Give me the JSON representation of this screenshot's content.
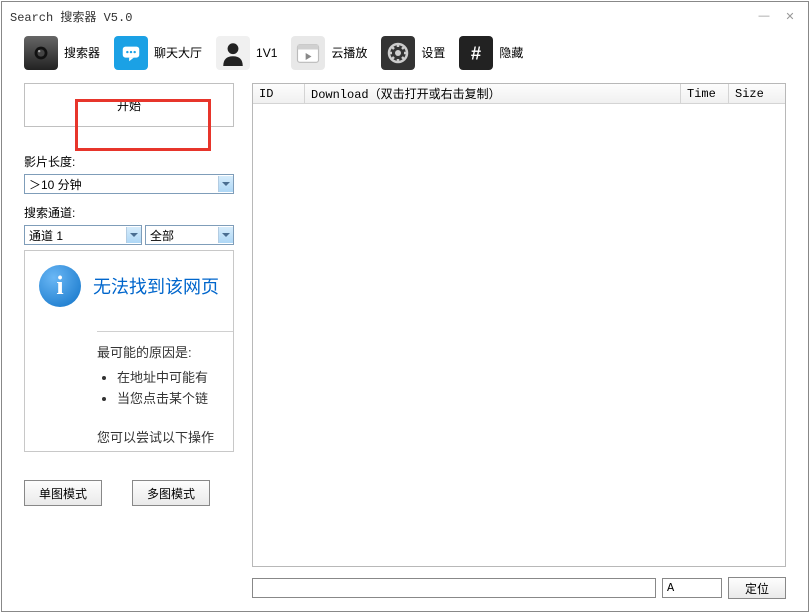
{
  "window": {
    "title": "Search 搜索器 V5.0"
  },
  "toolbar": {
    "items": [
      {
        "icon": "camera-icon",
        "label": "搜索器"
      },
      {
        "icon": "chat-icon",
        "label": "聊天大厅"
      },
      {
        "icon": "person-icon",
        "label": "1V1"
      },
      {
        "icon": "cloud-icon",
        "label": "云播放"
      },
      {
        "icon": "gear-icon",
        "label": "设置"
      },
      {
        "icon": "hash-icon",
        "label": "隐藏"
      }
    ]
  },
  "left": {
    "start_label": "开始",
    "length_label": "影片长度:",
    "length_value": "＞10 分钟",
    "channel_label": "搜索通道:",
    "channel_value": "通道 1",
    "channel_all": "全部",
    "info": {
      "title": "无法找到该网页",
      "reason_heading": "最可能的原因是:",
      "bullets": [
        "在地址中可能有",
        "当您点击某个链"
      ],
      "try_text": "您可以尝试以下操作"
    },
    "mode_single": "单图模式",
    "mode_multi": "多图模式"
  },
  "table": {
    "headers": {
      "id": "ID",
      "download": "Download（双击打开或右击复制）",
      "time": "Time",
      "size": "Size"
    }
  },
  "bottom": {
    "letter_value": "A",
    "locate_label": "定位"
  }
}
